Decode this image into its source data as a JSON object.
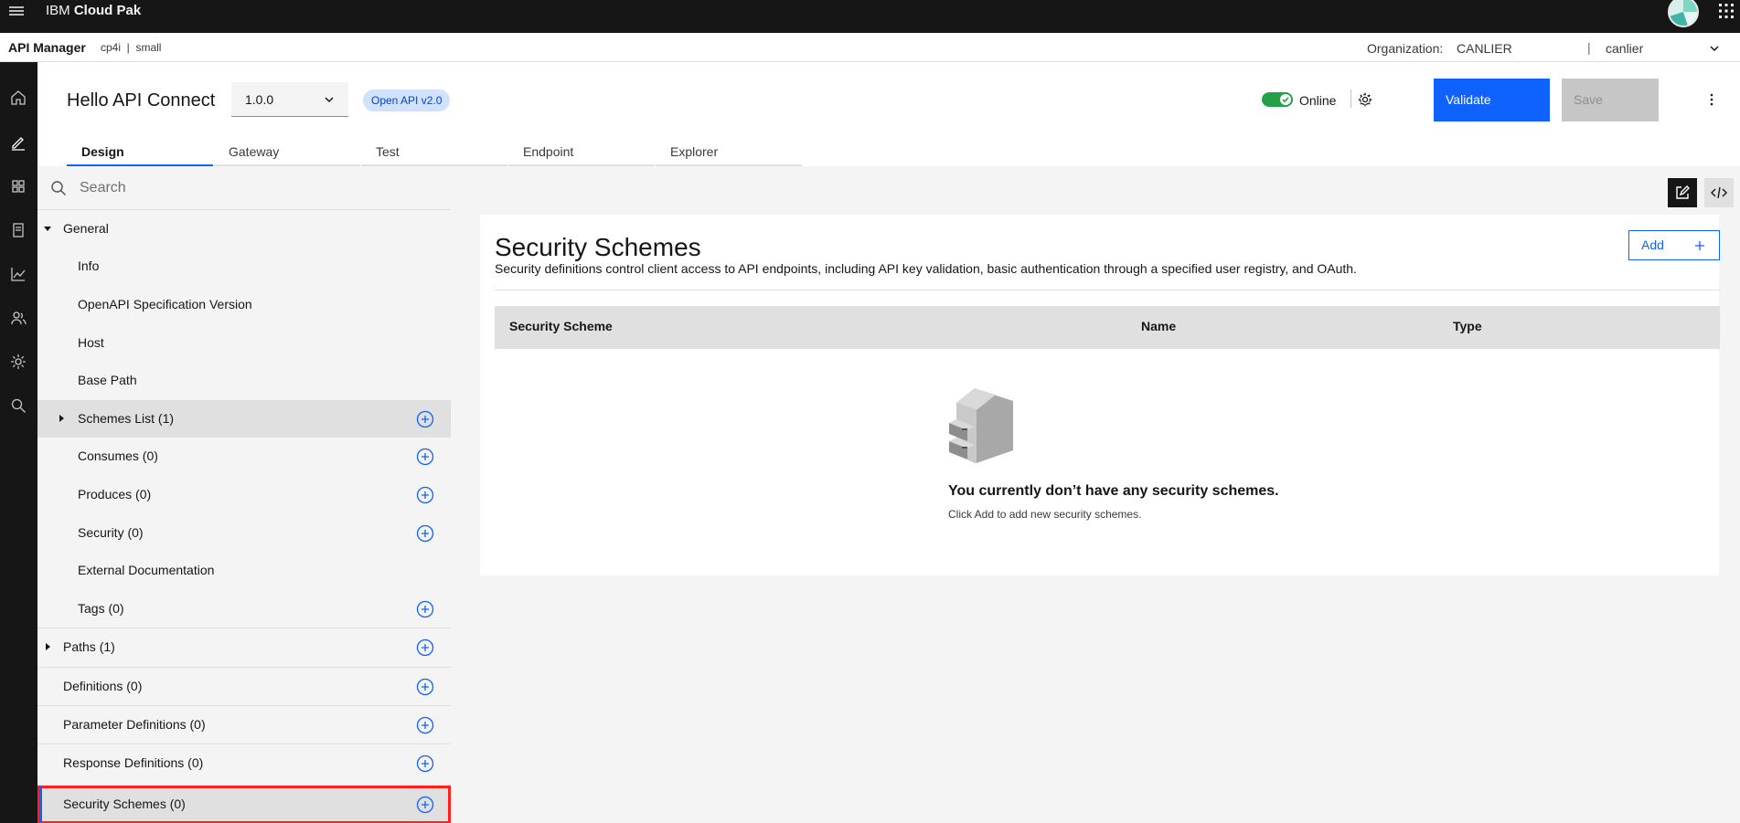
{
  "topbar": {
    "brand_prefix": "IBM",
    "brand_product": "Cloud Pak"
  },
  "subheader": {
    "app_name": "API Manager",
    "context": "cp4i  |  small",
    "org_label": "Organization:",
    "org_value": "CANLIER",
    "separator": "|",
    "user": "canlier"
  },
  "api": {
    "title": "Hello API Connect",
    "version": "1.0.0",
    "spec_badge": "Open API v2.0",
    "online_label": "Online",
    "validate_label": "Validate",
    "save_label": "Save"
  },
  "tabs": [
    "Design",
    "Gateway",
    "Test",
    "Endpoint",
    "Explorer"
  ],
  "nav": {
    "search_placeholder": "Search",
    "items": [
      {
        "label": "General"
      },
      {
        "label": "Info"
      },
      {
        "label": "OpenAPI Specification Version"
      },
      {
        "label": "Host"
      },
      {
        "label": "Base Path"
      },
      {
        "label": "Schemes List (1)"
      },
      {
        "label": "Consumes (0)"
      },
      {
        "label": "Produces (0)"
      },
      {
        "label": "Security (0)"
      },
      {
        "label": "External Documentation"
      },
      {
        "label": "Tags (0)"
      },
      {
        "label": "Paths (1)"
      },
      {
        "label": "Definitions (0)"
      },
      {
        "label": "Parameter Definitions (0)"
      },
      {
        "label": "Response Definitions (0)"
      },
      {
        "label": "Security Schemes (0)"
      }
    ]
  },
  "main": {
    "heading": "Security Schemes",
    "description": "Security definitions control client access to API endpoints, including API key validation, basic authentication through a specified user registry, and OAuth.",
    "add_label": "Add",
    "columns": [
      "Security Scheme",
      "Name",
      "Type"
    ],
    "empty_title": "You currently don’t have any security schemes.",
    "empty_subtitle": "Click Add to add new security schemes."
  },
  "colors": {
    "primary": "#0f62fe",
    "online": "#24a148",
    "highlight": "#ff1f1f"
  }
}
